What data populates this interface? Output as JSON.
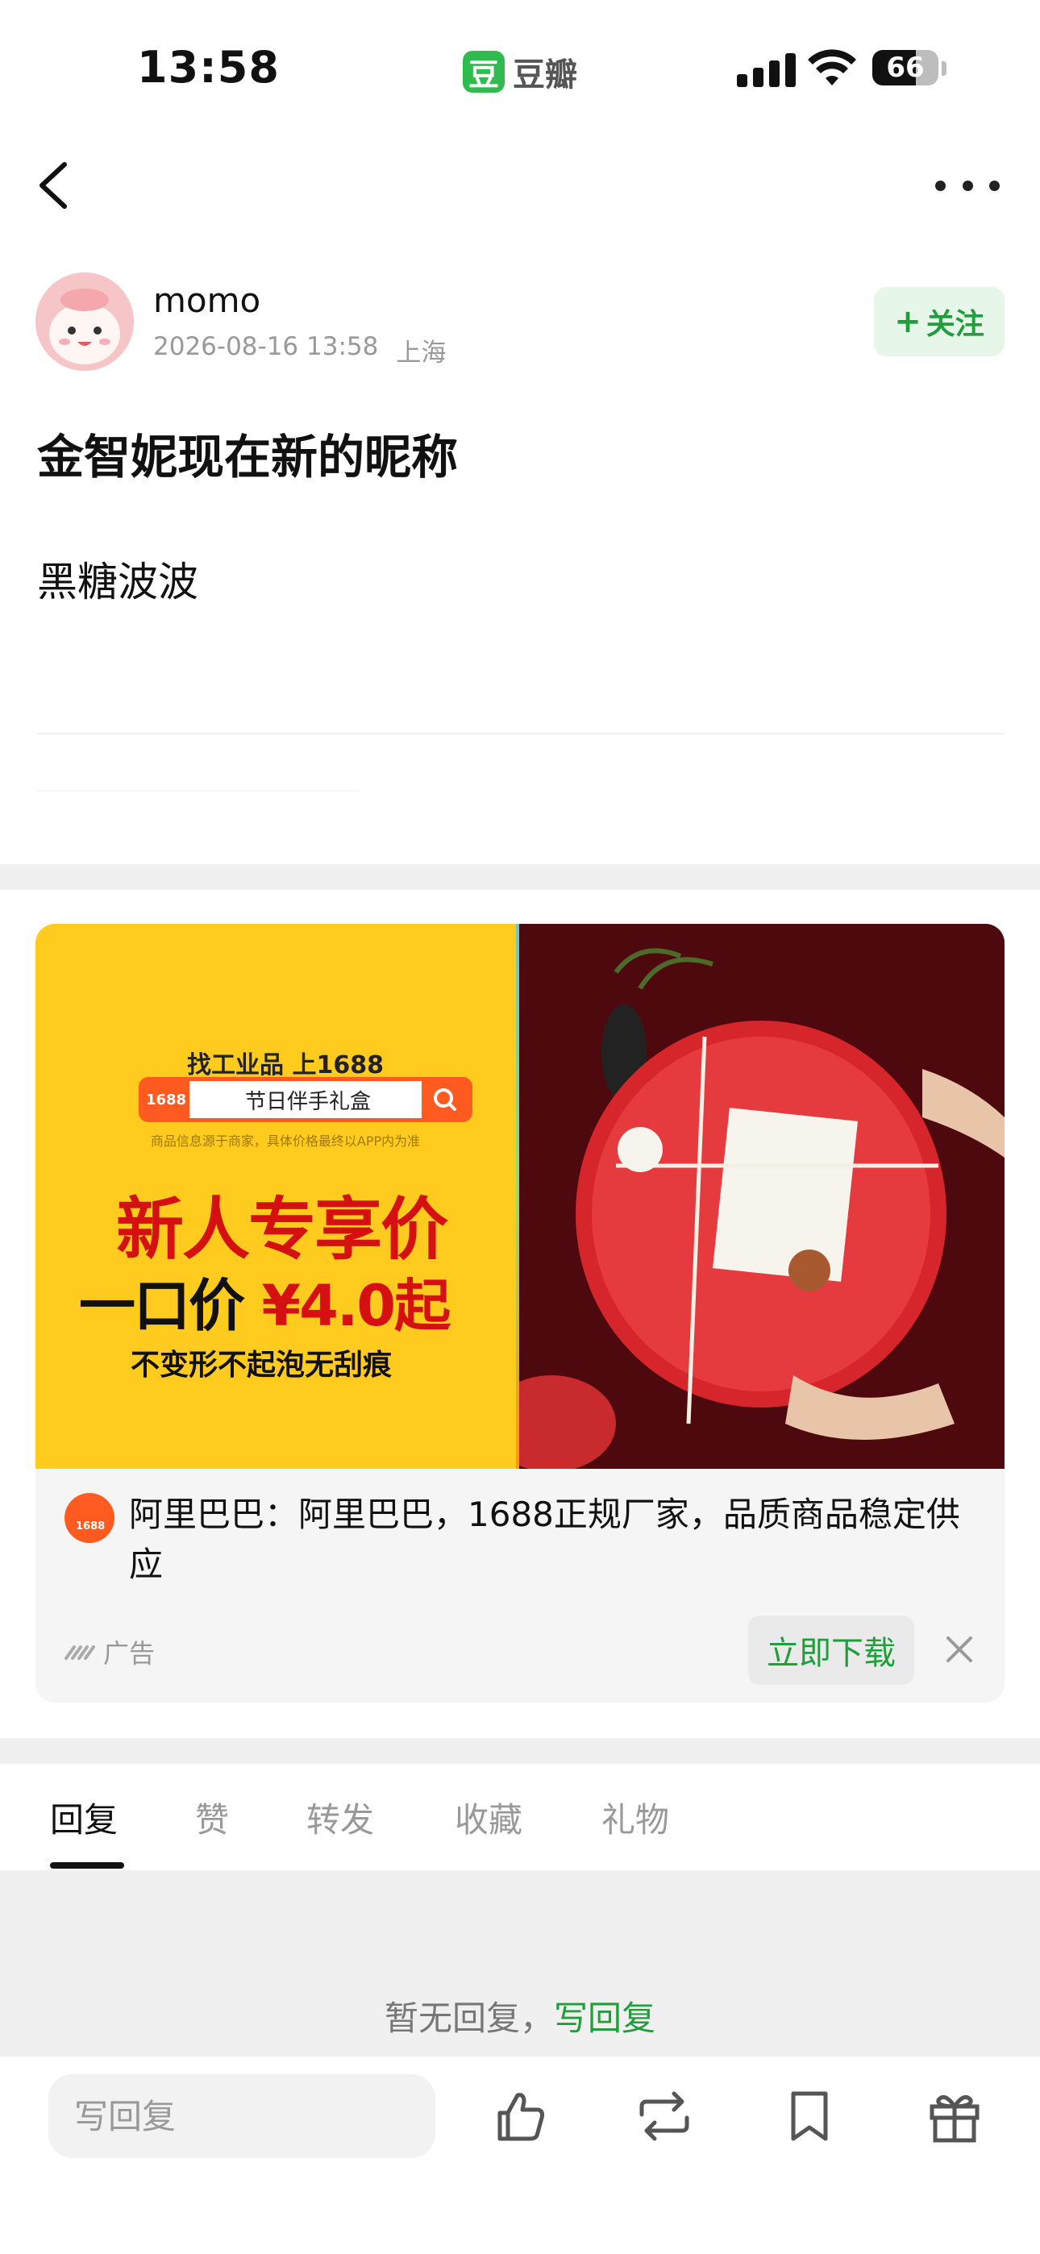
{
  "status_bar": {
    "time": "13:58",
    "app_icon_glyph": "豆",
    "app_name": "豆瓣",
    "battery": "66",
    "battery_level": 0.66,
    "accent_color": "#2fbb4f"
  },
  "nav": {
    "back_icon": "chevron-left-icon",
    "more_icon": "more-dots-icon"
  },
  "post": {
    "author": "momo",
    "date": "2026-08-16 13:58",
    "location": "上海",
    "follow_label": "关注",
    "title": "金智妮现在新的昵称",
    "body": "黑糖波波"
  },
  "ad": {
    "image": {
      "top_line": "找工业品 上1688",
      "logo_text": "1688",
      "search_query": "节日伴手礼盒",
      "note": "商品信息源于商家，具体价格最终以APP内为准",
      "headline_1": "新人专享价",
      "headline_2_prefix": "一口价",
      "headline_2_price": "¥4.0起",
      "headline_3": "不变形不起泡无刮痕"
    },
    "logo_text": "1688",
    "text": "阿里巴巴：阿里巴巴，1688正规厂家，品质商品稳定供应",
    "label": "广告",
    "download_label": "立即下载"
  },
  "tabs": [
    {
      "label": "回复",
      "active": true
    },
    {
      "label": "赞",
      "active": false
    },
    {
      "label": "转发",
      "active": false
    },
    {
      "label": "收藏",
      "active": false
    },
    {
      "label": "礼物",
      "active": false
    }
  ],
  "empty": {
    "text": "暂无回复，",
    "link": "写回复"
  },
  "bottom_bar": {
    "reply_placeholder": "写回复",
    "icons": [
      "thumbs-up-icon",
      "repost-icon",
      "bookmark-icon",
      "gift-icon"
    ]
  },
  "colors": {
    "green": "#1f9e3b",
    "follow_bg": "#e6f6e9",
    "ad_yellow": "#ffcb1f",
    "ad_red": "#d51010",
    "ad_orange": "#ff5a1f"
  }
}
